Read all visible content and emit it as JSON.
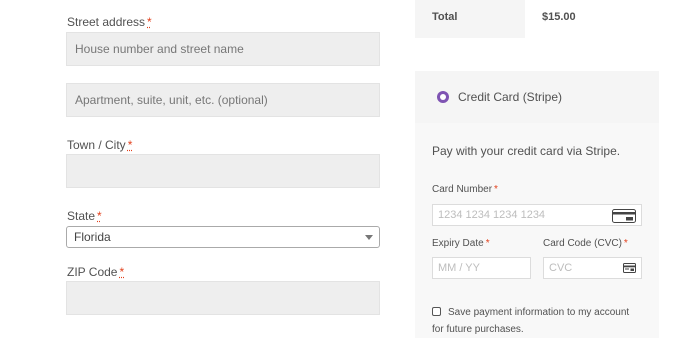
{
  "billing": {
    "street": {
      "label": "Street address",
      "required_mark": "*",
      "placeholder1": "House number and street name",
      "placeholder2": "Apartment, suite, unit, etc. (optional)"
    },
    "town": {
      "label": "Town / City",
      "required_mark": "*"
    },
    "state": {
      "label": "State",
      "required_mark": "*",
      "value": "Florida"
    },
    "zip": {
      "label": "ZIP Code",
      "required_mark": "*"
    }
  },
  "order_totals": {
    "label": "Total",
    "value": "$15.00"
  },
  "payment": {
    "method_label": "Credit Card (Stripe)",
    "accent_color": "#7f54b3",
    "description": "Pay with your credit card via Stripe.",
    "card_number": {
      "label": "Card Number",
      "required_mark": "*",
      "placeholder": "1234 1234 1234 1234"
    },
    "expiry": {
      "label": "Expiry Date",
      "required_mark": "*",
      "placeholder": "MM / YY"
    },
    "cvc": {
      "label": "Card Code (CVC)",
      "required_mark": "*",
      "placeholder": "CVC"
    },
    "save_line1": "Save payment information to my account",
    "save_line2": "for future purchases."
  },
  "icons": {
    "card": "credit-card-icon",
    "cvc": "card-cvc-icon"
  }
}
